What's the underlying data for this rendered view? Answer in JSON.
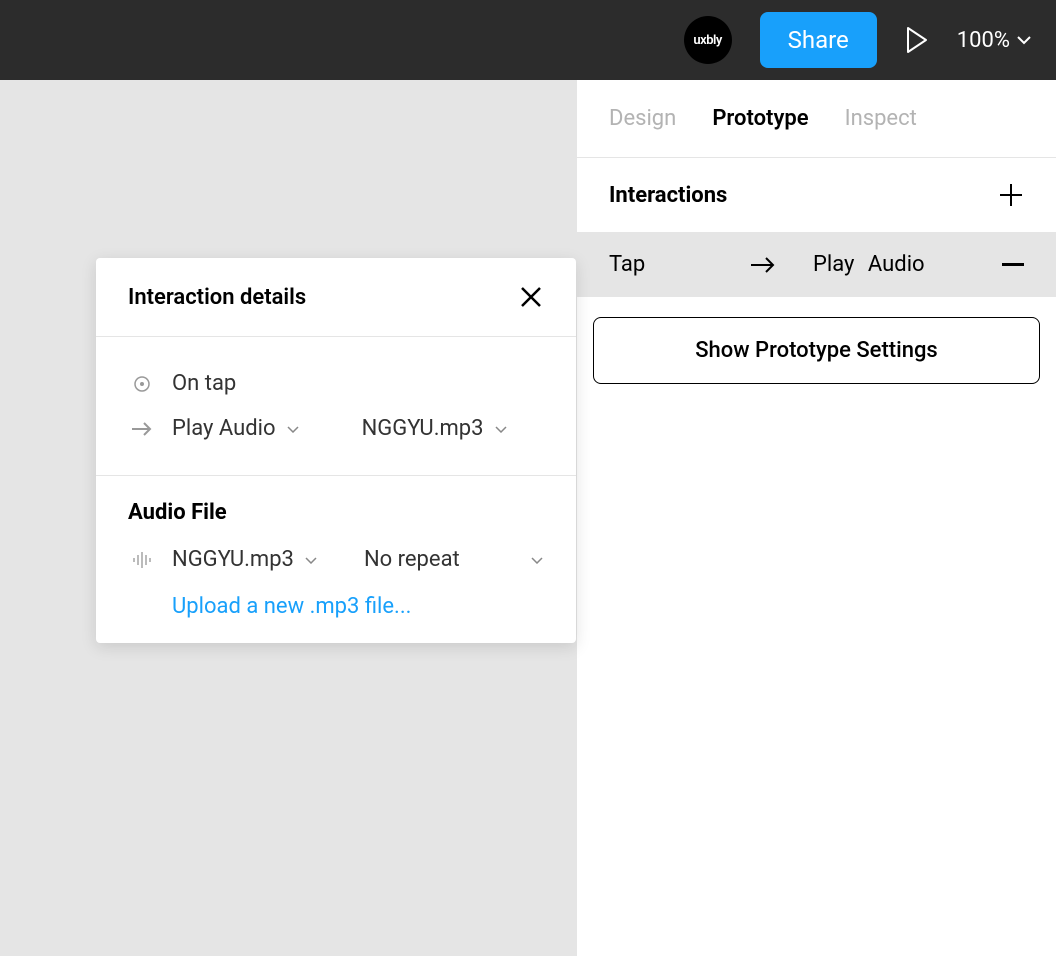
{
  "topbar": {
    "logo": "uxbly",
    "share_label": "Share",
    "zoom": "100%"
  },
  "tabs": {
    "design": "Design",
    "prototype": "Prototype",
    "inspect": "Inspect"
  },
  "interactions": {
    "title": "Interactions",
    "row": {
      "trigger": "Tap",
      "action1": "Play",
      "action2": "Audio"
    },
    "show_settings": "Show Prototype Settings"
  },
  "popup": {
    "title": "Interaction details",
    "trigger": "On tap",
    "action": "Play Audio",
    "audio_name": "NGGYU.mp3",
    "section_title": "Audio File",
    "file_name": "NGGYU.mp3",
    "repeat": "No repeat",
    "upload": "Upload a new .mp3 file..."
  }
}
